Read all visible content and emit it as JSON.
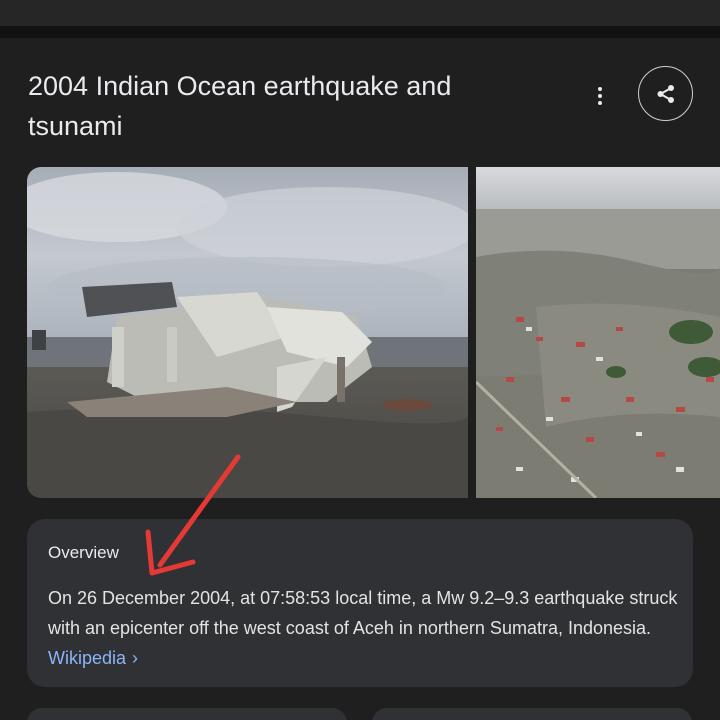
{
  "title": "2004 Indian Ocean earthquake and tsunami",
  "icons": {
    "more": "more-vert-icon",
    "share": "share-icon",
    "chevron": "chevron-right-icon"
  },
  "images": [
    {
      "name": "collapsed-house-photo"
    },
    {
      "name": "flooded-town-aerial-photo"
    }
  ],
  "overview": {
    "heading": "Overview",
    "text": "On 26 December 2004, at 07:58:53 local time, a Mw 9.2–9.3 earthquake struck with an epicenter off the west coast of Aceh in northern Sumatra, Indonesia.",
    "link_label": "Wikipedia",
    "link_chevron": "›"
  },
  "annotation": {
    "arrow_color": "#e53935"
  }
}
